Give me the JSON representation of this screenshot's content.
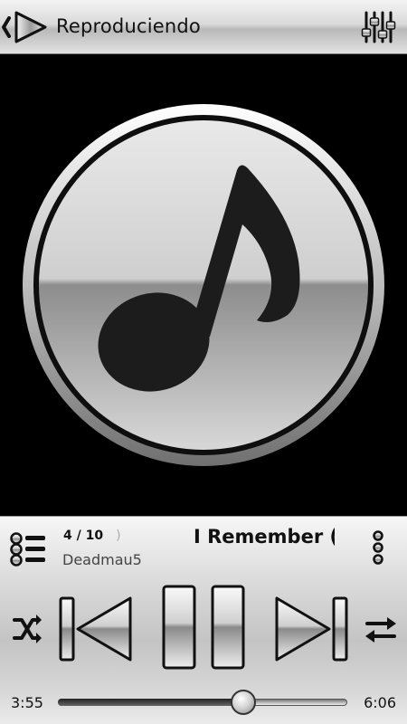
{
  "header": {
    "title": "Reproduciendo",
    "back_icon": "back-arrow-icon",
    "equalizer_icon": "equalizer-sliders-icon"
  },
  "artwork": {
    "icon": "music-note-icon"
  },
  "now_playing": {
    "track_position": "4 / 10",
    "track_position_ghost": ")",
    "title": "I Remember (Original Mix)",
    "artist": "Deadmau5",
    "queue_icon": "queue-list-icon",
    "more_icon": "more-vertical-icon"
  },
  "controls": {
    "shuffle_icon": "shuffle-icon",
    "previous_icon": "previous-track-icon",
    "pause_icon": "pause-icon",
    "next_icon": "next-track-icon",
    "repeat_icon": "repeat-icon"
  },
  "progress": {
    "current_time": "3:55",
    "total_time": "6:06",
    "fraction": 0.642
  },
  "colors": {
    "background": "#000000",
    "chrome_light": "#f4f4f4",
    "chrome_dark": "#b9b9b9",
    "text": "#111111"
  }
}
